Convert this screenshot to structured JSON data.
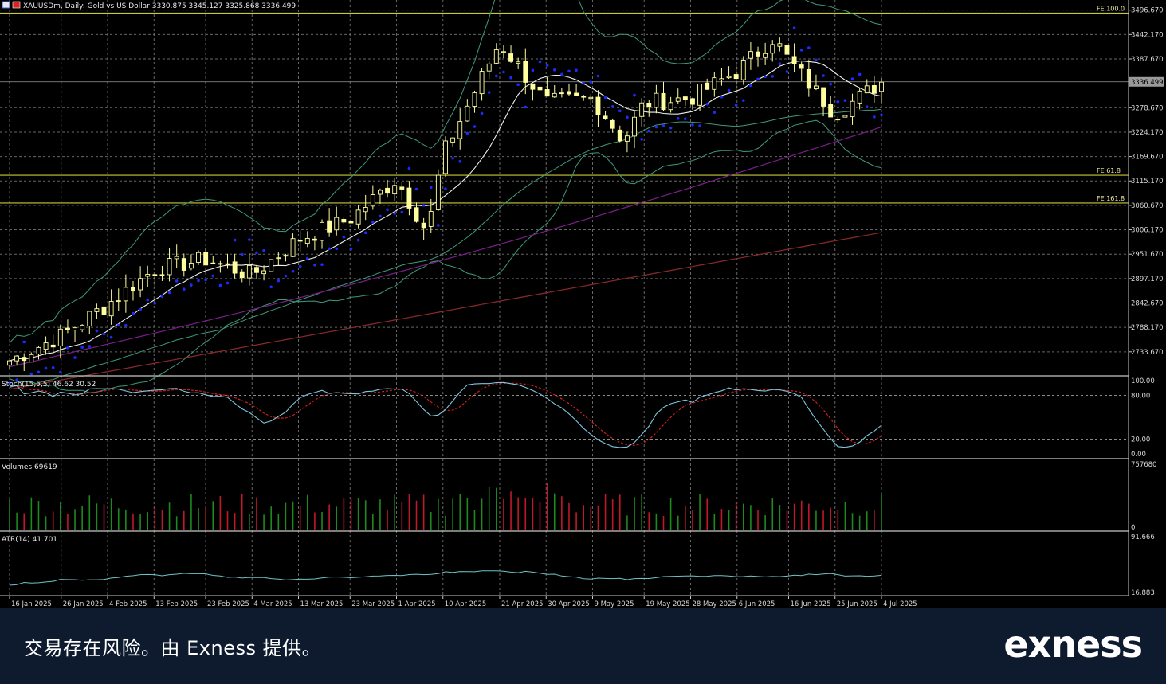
{
  "window": {
    "symbol_header": "XAUUSDm, Daily:  Gold vs US Dollar  3330.875 3345.127 3325.868 3336.499"
  },
  "colors": {
    "background": "#000000",
    "grid": "#8a8a8a",
    "candle": "#ffff9e",
    "sar": "#1a2cff",
    "ma_fast": "#f0f0f0",
    "bollinger": "#3f9a7a",
    "ma_slow": "#7a1f8a",
    "ma_long": "#8a2a2a",
    "fibo": "#c8c83a",
    "stoch_main": "#7ec6e0",
    "stoch_signal": "#e02020",
    "vol_up": "#1e8a1e",
    "vol_down": "#c0182a",
    "atr": "#6ec3c8",
    "footer_bg": "#0e1b2f"
  },
  "price_panel": {
    "ylim": [
      2680,
      3505
    ],
    "y_ticks": [
      "3496.670",
      "3442.170",
      "3387.670",
      "3278.670",
      "3224.170",
      "3169.670",
      "3115.170",
      "3060.670",
      "3006.170",
      "2951.670",
      "2897.170",
      "2842.670",
      "2788.170",
      "2733.670"
    ],
    "current_price_label": "3336.499",
    "current_price": 3336.499,
    "fibo_levels": [
      {
        "label": "FE 100.0",
        "price": 3490
      },
      {
        "label": "FE 61.8",
        "price": 3128
      },
      {
        "label": "FE 161.8",
        "price": 3066
      }
    ]
  },
  "stoch_panel": {
    "label": "Stoch(15,5,5) 46.62 30.52",
    "y_ticks": [
      "100.00",
      "80.00",
      "20.00",
      "0.00"
    ],
    "levels": [
      80,
      20
    ]
  },
  "volume_panel": {
    "label": "Volumes 69619",
    "y_ticks": [
      "757680",
      "0"
    ]
  },
  "atr_panel": {
    "label": "ATR(14) 41.701",
    "y_ticks": [
      "91.666",
      "16.883"
    ]
  },
  "x_labels": [
    "16 Jan 2025",
    "26 Jan 2025",
    "4 Feb 2025",
    "13 Feb 2025",
    "23 Feb 2025",
    "4 Mar 2025",
    "13 Mar 2025",
    "23 Mar 2025",
    "1 Apr 2025",
    "10 Apr 2025",
    "21 Apr 2025",
    "30 Apr 2025",
    "9 May 2025",
    "19 May 2025",
    "28 May 2025",
    "6 Jun 2025",
    "16 Jun 2025",
    "25 Jun 2025",
    "4 Jul 2025"
  ],
  "footer": {
    "disclaimer": "交易存在风险。由 Exness 提供。",
    "brand": "exness"
  },
  "chart_data": {
    "type": "candlestick",
    "title": "XAUUSDm, Daily: Gold vs US Dollar",
    "x_start": "16 Jan 2025",
    "x_end": "4 Jul 2025",
    "ylim": [
      2680,
      3505
    ],
    "close_path": [
      {
        "date": "16 Jan 2025",
        "price": 2714
      },
      {
        "date": "26 Jan 2025",
        "price": 2770
      },
      {
        "date": "4 Feb 2025",
        "price": 2840
      },
      {
        "date": "13 Feb 2025",
        "price": 2918
      },
      {
        "date": "23 Feb 2025",
        "price": 2940
      },
      {
        "date": "4 Mar 2025",
        "price": 2905
      },
      {
        "date": "13 Mar 2025",
        "price": 2985
      },
      {
        "date": "23 Mar 2025",
        "price": 3030
      },
      {
        "date": "1 Apr 2025",
        "price": 3120
      },
      {
        "date": "7 Apr 2025",
        "price": 3000
      },
      {
        "date": "10 Apr 2025",
        "price": 3175
      },
      {
        "date": "21 Apr 2025",
        "price": 3425
      },
      {
        "date": "30 Apr 2025",
        "price": 3290
      },
      {
        "date": "9 May 2025",
        "price": 3300
      },
      {
        "date": "15 May 2025",
        "price": 3205
      },
      {
        "date": "19 May 2025",
        "price": 3290
      },
      {
        "date": "28 May 2025",
        "price": 3300
      },
      {
        "date": "6 Jun 2025",
        "price": 3360
      },
      {
        "date": "13 Jun 2025",
        "price": 3435
      },
      {
        "date": "16 Jun 2025",
        "price": 3385
      },
      {
        "date": "25 Jun 2025",
        "price": 3265
      },
      {
        "date": "4 Jul 2025",
        "price": 3336
      }
    ],
    "grid": true
  }
}
